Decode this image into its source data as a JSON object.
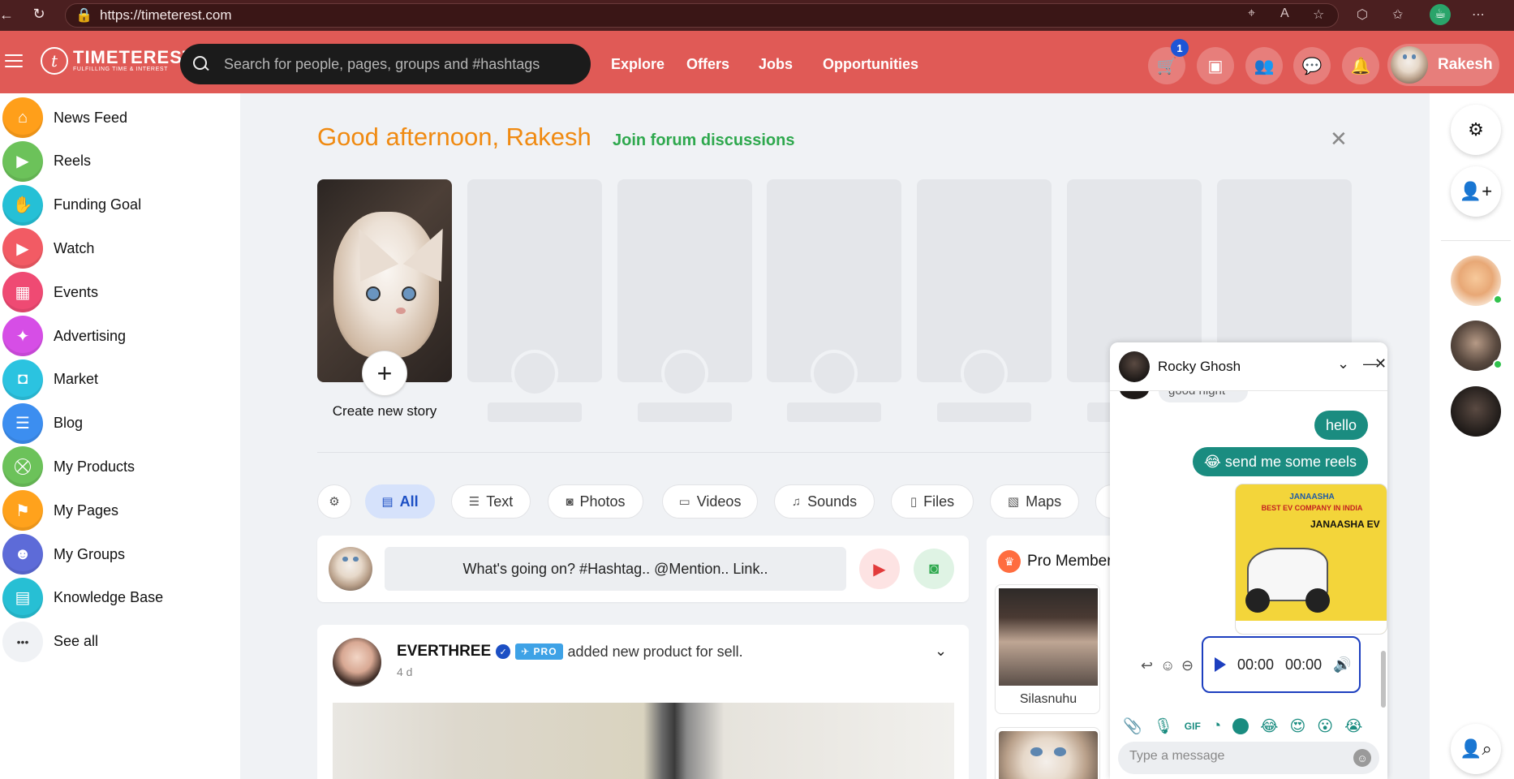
{
  "browser": {
    "url": "https://timeterest.com"
  },
  "header": {
    "logo_name": "TIMETEREST",
    "logo_tagline": "FULFILLING TIME & INTEREST",
    "logo_letter": "t",
    "search_placeholder": "Search for people, pages, groups and #hashtags",
    "nav": [
      "Explore",
      "Offers",
      "Jobs",
      "Opportunities"
    ],
    "cart_count": "1",
    "user_name": "Rakesh"
  },
  "sidebar": {
    "items": [
      {
        "label": "News Feed",
        "icon": "home-icon",
        "color": "#ff9f1a",
        "glyph": "⌂"
      },
      {
        "label": "Reels",
        "icon": "reels-icon",
        "color": "#6cc25a",
        "glyph": "▶"
      },
      {
        "label": "Funding Goal",
        "icon": "funding-icon",
        "color": "#25c0d6",
        "glyph": "✋"
      },
      {
        "label": "Watch",
        "icon": "watch-icon",
        "color": "#f25b64",
        "glyph": "▶"
      },
      {
        "label": "Events",
        "icon": "calendar-icon",
        "color": "#ef4a73",
        "glyph": "▦"
      },
      {
        "label": "Advertising",
        "icon": "megaphone-icon",
        "color": "#d64ee6",
        "glyph": "✦"
      },
      {
        "label": "Market",
        "icon": "bag-icon",
        "color": "#2bc3e0",
        "glyph": "◘"
      },
      {
        "label": "Blog",
        "icon": "blog-icon",
        "color": "#3c8ef0",
        "glyph": "☰"
      },
      {
        "label": "My Products",
        "icon": "cart-icon",
        "color": "#6cc25a",
        "glyph": "⛒"
      },
      {
        "label": "My Pages",
        "icon": "flag-icon",
        "color": "#ffa21c",
        "glyph": "⚑"
      },
      {
        "label": "My Groups",
        "icon": "groups-icon",
        "color": "#5d6bd8",
        "glyph": "☻"
      },
      {
        "label": "Knowledge Base",
        "icon": "knowledge-icon",
        "color": "#27bfd4",
        "glyph": "▤"
      },
      {
        "label": "See all",
        "icon": "more-icon",
        "color": "#f0f2f5",
        "glyph": "•••"
      }
    ]
  },
  "greeting": {
    "text": "Good afternoon, Rakesh",
    "link": "Join forum discussions"
  },
  "stories": {
    "create_label": "Create new story"
  },
  "filters": [
    {
      "label": "All",
      "icon": "all-icon",
      "glyph": "▤"
    },
    {
      "label": "Text",
      "icon": "text-icon",
      "glyph": "☰"
    },
    {
      "label": "Photos",
      "icon": "camera-icon",
      "glyph": "◙"
    },
    {
      "label": "Videos",
      "icon": "video-icon",
      "glyph": "▭"
    },
    {
      "label": "Sounds",
      "icon": "music-icon",
      "glyph": "♫"
    },
    {
      "label": "Files",
      "icon": "file-icon",
      "glyph": "▯"
    },
    {
      "label": "Maps",
      "icon": "map-icon",
      "glyph": "▧"
    }
  ],
  "composer": {
    "placeholder": "What's going on? #Hashtag.. @Mention.. Link.."
  },
  "post": {
    "author": "EVERTHREE",
    "badge": "PRO",
    "action": "added new product for sell.",
    "time": "4 d"
  },
  "pro_members": {
    "title": "Pro Members",
    "members": [
      "Silasnuhu"
    ]
  },
  "chat": {
    "name": "Rocky Ghosh",
    "old_message": "good night",
    "messages": [
      "hello",
      "😂 send me some reels"
    ],
    "image": {
      "brand": "JANAASHA",
      "tagline": "BEST EV COMPANY IN INDIA",
      "title": "JANAASHA EV"
    },
    "audio": {
      "current": "00:00",
      "total": "00:00"
    },
    "gif_label": "GIF",
    "emojis": [
      "😂",
      "😍",
      "😮",
      "😭"
    ],
    "input_placeholder": "Type a message"
  },
  "colors": {
    "header": "#e05a56",
    "greeting": "#f08a11",
    "forum_link": "#2ea84d",
    "chat_bubble": "#1a8c80",
    "accent": "#1c4fc4"
  }
}
